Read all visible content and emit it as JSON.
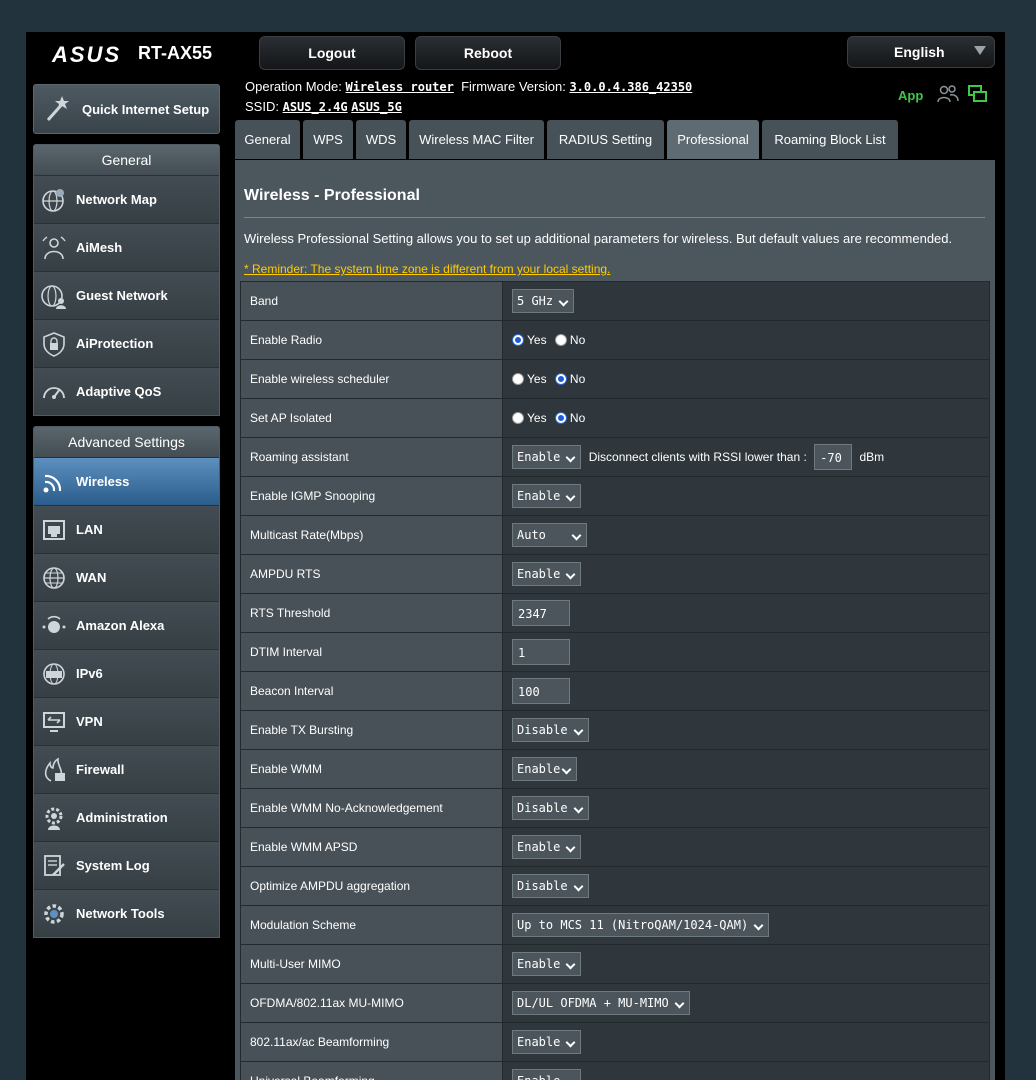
{
  "header": {
    "brand": "ASUS",
    "model": "RT-AX55",
    "logout_label": "Logout",
    "reboot_label": "Reboot",
    "language": "English",
    "operation_mode_label": "Operation Mode:",
    "operation_mode": "Wireless router",
    "firmware_label": "Firmware Version:",
    "firmware": "3.0.0.4.386_42350",
    "ssid_label": "SSID:",
    "ssid_24": "ASUS_2.4G",
    "ssid_5": "ASUS_5G",
    "app_label": "App"
  },
  "sidebar": {
    "qis": "Quick Internet Setup",
    "general_title": "General",
    "general_items": [
      "Network Map",
      "AiMesh",
      "Guest Network",
      "AiProtection",
      "Adaptive QoS"
    ],
    "advanced_title": "Advanced Settings",
    "advanced_items": [
      "Wireless",
      "LAN",
      "WAN",
      "Amazon Alexa",
      "IPv6",
      "VPN",
      "Firewall",
      "Administration",
      "System Log",
      "Network Tools"
    ]
  },
  "tabs": [
    "General",
    "WPS",
    "WDS",
    "Wireless MAC Filter",
    "RADIUS Setting",
    "Professional",
    "Roaming Block List"
  ],
  "content": {
    "title": "Wireless - Professional",
    "description": "Wireless Professional Setting allows you to set up additional parameters for wireless. But default values are recommended.",
    "reminder": "* Reminder: The system time zone is different from your local setting."
  },
  "radio": {
    "yes": "Yes",
    "no": "No"
  },
  "settings": {
    "band": {
      "label": "Band",
      "value": "5 GHz"
    },
    "enable_radio": {
      "label": "Enable Radio"
    },
    "scheduler": {
      "label": "Enable wireless scheduler"
    },
    "ap_isolated": {
      "label": "Set AP Isolated"
    },
    "roaming": {
      "label": "Roaming assistant",
      "value": "Enable",
      "text": "Disconnect clients with RSSI lower than :",
      "rssi": "-70",
      "unit": "dBm"
    },
    "igmp": {
      "label": "Enable IGMP Snooping",
      "value": "Enable"
    },
    "multicast": {
      "label": "Multicast Rate(Mbps)",
      "value": "Auto"
    },
    "ampdu_rts": {
      "label": "AMPDU RTS",
      "value": "Enable"
    },
    "rts_threshold": {
      "label": "RTS Threshold",
      "value": "2347"
    },
    "dtim": {
      "label": "DTIM Interval",
      "value": "1"
    },
    "beacon": {
      "label": "Beacon Interval",
      "value": "100"
    },
    "tx_bursting": {
      "label": "Enable TX Bursting",
      "value": "Disable"
    },
    "wmm": {
      "label": "Enable WMM",
      "value": "Enable"
    },
    "wmm_noack": {
      "label": "Enable WMM No-Acknowledgement",
      "value": "Disable"
    },
    "wmm_apsd": {
      "label": "Enable WMM APSD",
      "value": "Enable"
    },
    "ampdu_agg": {
      "label": "Optimize AMPDU aggregation",
      "value": "Disable"
    },
    "modulation": {
      "label": "Modulation Scheme",
      "value": "Up to MCS 11 (NitroQAM/1024-QAM)"
    },
    "mu_mimo": {
      "label": "Multi-User MIMO",
      "value": "Enable"
    },
    "ofdma": {
      "label": "OFDMA/802.11ax MU-MIMO",
      "value": "DL/UL OFDMA + MU-MIMO"
    },
    "beamforming": {
      "label": "802.11ax/ac Beamforming",
      "value": "Enable"
    },
    "universal_bf": {
      "label": "Universal Beamforming",
      "value": "Enable"
    }
  }
}
